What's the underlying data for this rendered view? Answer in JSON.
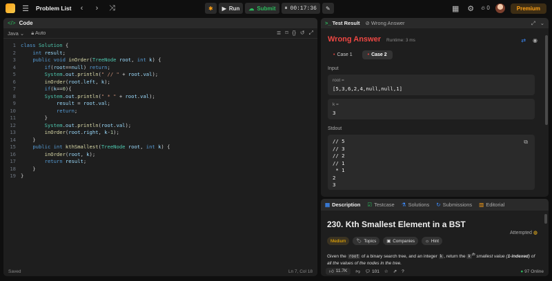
{
  "topbar": {
    "title": "Problem List",
    "run_label": "Run",
    "submit_label": "Submit",
    "timer": "00:17:36",
    "streak": "0",
    "premium_label": "Premium"
  },
  "code": {
    "title": "Code",
    "language": "Java",
    "auto_label": "Auto",
    "status_saved": "Saved",
    "cursor": "Ln 7, Col 18",
    "line_numbers": [
      "1",
      "2",
      "3",
      "4",
      "5",
      "6",
      "7",
      "8",
      "9",
      "10",
      "11",
      "12",
      "13",
      "14",
      "15",
      "16",
      "17",
      "18",
      "19"
    ],
    "lines": [
      "class Solution {",
      "    int result;",
      "    public void inOrder(TreeNode root, int k) {",
      "        if(root==null) return;",
      "        System.out.println(\" // \" + root.val);",
      "        inOrder(root.left, k);",
      "        if(k==0){",
      "        System.out.println(\" * \" + root.val);",
      "            result = root.val;",
      "            return;",
      "        }",
      "        System.out.println(root.val);",
      "        inOrder(root.right, k-1);",
      "    }",
      "    public int kthSmallest(TreeNode root, int k) {",
      "        inOrder(root, k);",
      "        return result;",
      "    }",
      "}"
    ]
  },
  "result": {
    "tab_active": "Test Result",
    "tab_inactive": "Wrong Answer",
    "verdict": "Wrong Answer",
    "runtime": "Runtime: 3 ms",
    "cases": [
      "Case 1",
      "Case 2"
    ],
    "input_label": "Input",
    "root_key": "root =",
    "root_value": "[5,3,6,2,4,null,null,1]",
    "k_key": "k =",
    "k_value": "3",
    "stdout_label": "Stdout",
    "stdout_lines": [
      "// 5",
      "// 3",
      "// 2",
      "// 1",
      " * 1",
      "2",
      "3"
    ]
  },
  "description": {
    "tabs": [
      "Description",
      "Testcase",
      "Solutions",
      "Submissions",
      "Editorial"
    ],
    "title": "230. Kth Smallest Element in a BST",
    "attempted": "Attempted",
    "tags": [
      "Medium",
      "Topics",
      "Companies",
      "Hint"
    ],
    "text_1": "Given the",
    "text_code_root": "root",
    "text_2": "of a binary search tree, and an integer",
    "text_code_k": "k",
    "text_3": ", return the",
    "text_code_kth": "k",
    "text_sup": "th",
    "text_4": "smallest value (",
    "text_5": "1-indexed",
    "text_6": ") of all the values of the nodes in the tree.",
    "likes": "11.7K",
    "comments": "101",
    "online": "97 Online"
  },
  "colors": {
    "accent": "#ffa116",
    "wrong": "#ef4743",
    "submit_green": "#2cbb5d",
    "medium": "#ffb800"
  }
}
